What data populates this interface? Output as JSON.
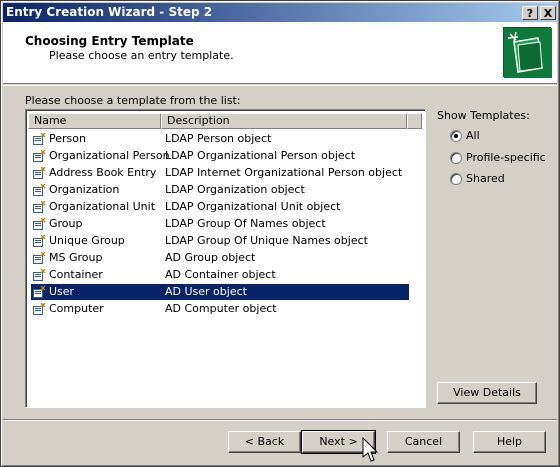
{
  "window": {
    "title": "Entry Creation Wizard - Step 2",
    "help_button": "?",
    "close_button": "X"
  },
  "header": {
    "title": "Choosing Entry Template",
    "subtitle": "Please choose an entry template."
  },
  "list": {
    "caption": "Please choose a template from the list:",
    "columns": [
      "Name",
      "Description"
    ],
    "rows": [
      {
        "name": "Person",
        "description": "LDAP Person object"
      },
      {
        "name": "Organizational Person",
        "description": "LDAP Organizational Person object"
      },
      {
        "name": "Address Book Entry",
        "description": "LDAP Internet Organizational Person object"
      },
      {
        "name": "Organization",
        "description": "LDAP Organization object"
      },
      {
        "name": "Organizational Unit",
        "description": "LDAP Organizational Unit object"
      },
      {
        "name": "Group",
        "description": "LDAP Group Of Names object"
      },
      {
        "name": "Unique Group",
        "description": "LDAP Group Of Unique Names object"
      },
      {
        "name": "MS Group",
        "description": "AD Group object"
      },
      {
        "name": "Container",
        "description": "AD Container object"
      },
      {
        "name": "User",
        "description": "AD User object"
      },
      {
        "name": "Computer",
        "description": "AD Computer object"
      }
    ],
    "selected_index": 9
  },
  "show_templates": {
    "label": "Show Templates:",
    "options": [
      "All",
      "Profile-specific",
      "Shared"
    ],
    "selected": "All"
  },
  "buttons": {
    "view_details": "View Details",
    "back": "< Back",
    "next": "Next >",
    "cancel": "Cancel",
    "help": "Help"
  },
  "colors": {
    "title_bar_start": "#0a246a",
    "selection": "#0a246a",
    "dialog_face": "#d4d0c8"
  }
}
